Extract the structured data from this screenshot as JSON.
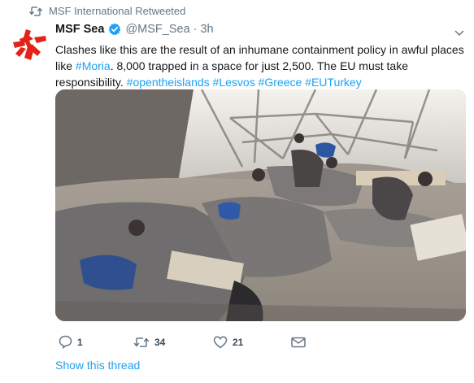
{
  "retweet": {
    "label": "MSF International Retweeted"
  },
  "tweet": {
    "name": "MSF Sea",
    "handle": "@MSF_Sea",
    "separator": "·",
    "time": "3h",
    "text": [
      {
        "t": "Clashes like this are the result of an inhumane containment policy in awful places like ",
        "tag": false
      },
      {
        "t": "#Moria",
        "tag": true
      },
      {
        "t": ". 8,000 trapped in a space for just 2,500. The EU must take responsibility. ",
        "tag": false
      },
      {
        "t": "#opentheislands",
        "tag": true
      },
      {
        "t": " ",
        "tag": false
      },
      {
        "t": "#Lesvos",
        "tag": true
      },
      {
        "t": " ",
        "tag": false
      },
      {
        "t": "#Greece",
        "tag": true
      },
      {
        "t": " ",
        "tag": false
      },
      {
        "t": "#EUTurkey",
        "tag": true
      }
    ]
  },
  "actions": {
    "replies": "1",
    "retweets": "34",
    "likes": "21"
  },
  "thread": {
    "label": "Show this thread"
  },
  "colors": {
    "accent": "#1da1f2",
    "muted": "#657786",
    "brand_red": "#e2231a"
  }
}
